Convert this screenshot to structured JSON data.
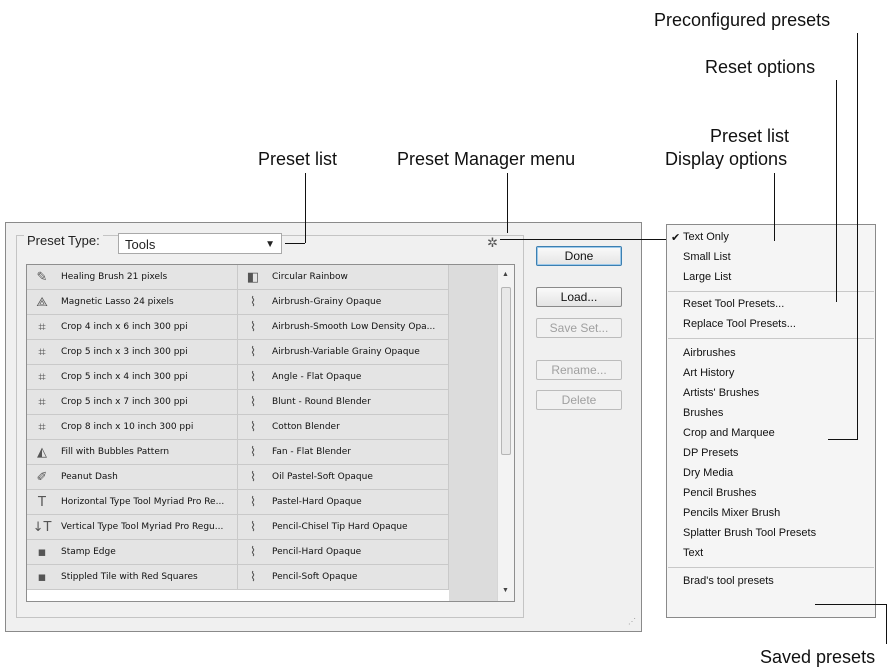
{
  "callouts": {
    "preconfigured_presets": "Preconfigured presets",
    "reset_options": "Reset options",
    "preset_list_display_1": "Preset list",
    "preset_list_display_2": "Display options",
    "preset_list": "Preset list",
    "preset_manager_menu": "Preset Manager menu",
    "saved_presets": "Saved presets"
  },
  "dialog": {
    "preset_type_label": "Preset Type:",
    "preset_type_value": "Tools",
    "list_col1": [
      {
        "label": "Healing Brush 21 pixels",
        "icon": "healing-brush-icon"
      },
      {
        "label": "Magnetic Lasso 24 pixels",
        "icon": "magnetic-lasso-icon"
      },
      {
        "label": "Crop 4 inch x 6 inch 300 ppi",
        "icon": "crop-icon"
      },
      {
        "label": "Crop 5 inch x 3 inch 300 ppi",
        "icon": "crop-icon"
      },
      {
        "label": "Crop 5 inch x 4 inch 300 ppi",
        "icon": "crop-icon"
      },
      {
        "label": "Crop 5 inch x 7 inch 300 ppi",
        "icon": "crop-icon"
      },
      {
        "label": "Crop 8 inch x 10 inch 300 ppi",
        "icon": "crop-icon"
      },
      {
        "label": "Fill with Bubbles Pattern",
        "icon": "paint-bucket-icon"
      },
      {
        "label": "Peanut Dash",
        "icon": "pencil-icon"
      },
      {
        "label": "Horizontal Type Tool Myriad Pro Re...",
        "icon": "type-icon"
      },
      {
        "label": "Vertical Type Tool Myriad Pro Regu...",
        "icon": "vertical-type-icon"
      },
      {
        "label": "Stamp Edge",
        "icon": "square-icon"
      },
      {
        "label": "Stippled Tile with Red Squares",
        "icon": "square-icon"
      }
    ],
    "list_col2": [
      {
        "label": "Circular Rainbow",
        "icon": "gradient-icon"
      },
      {
        "label": "Airbrush-Grainy Opaque",
        "icon": "brush-icon"
      },
      {
        "label": "Airbrush-Smooth Low Density Opa...",
        "icon": "brush-icon"
      },
      {
        "label": "Airbrush-Variable Grainy Opaque",
        "icon": "brush-icon"
      },
      {
        "label": "Angle - Flat Opaque",
        "icon": "brush-icon"
      },
      {
        "label": "Blunt - Round Blender",
        "icon": "brush-icon"
      },
      {
        "label": "Cotton Blender",
        "icon": "brush-icon"
      },
      {
        "label": "Fan - Flat Blender",
        "icon": "brush-icon"
      },
      {
        "label": "Oil Pastel-Soft Opaque",
        "icon": "brush-icon"
      },
      {
        "label": "Pastel-Hard Opaque",
        "icon": "brush-icon"
      },
      {
        "label": "Pencil-Chisel Tip Hard Opaque",
        "icon": "brush-icon"
      },
      {
        "label": "Pencil-Hard Opaque",
        "icon": "brush-icon"
      },
      {
        "label": "Pencil-Soft Opaque",
        "icon": "brush-icon"
      }
    ],
    "buttons": {
      "done": "Done",
      "load": "Load...",
      "save_set": "Save Set...",
      "rename": "Rename...",
      "delete": "Delete"
    }
  },
  "menu": {
    "display": [
      "Text Only",
      "Small List",
      "Large List"
    ],
    "checked": "Text Only",
    "reset": [
      "Reset Tool Presets...",
      "Replace Tool Presets..."
    ],
    "presets": [
      "Airbrushes",
      "Art History",
      "Artists' Brushes",
      "Brushes",
      "Crop and Marquee",
      "DP Presets",
      "Dry Media",
      "Pencil Brushes",
      "Pencils Mixer Brush",
      "Splatter Brush Tool Presets",
      "Text"
    ],
    "saved": [
      "Brad's tool presets"
    ]
  }
}
